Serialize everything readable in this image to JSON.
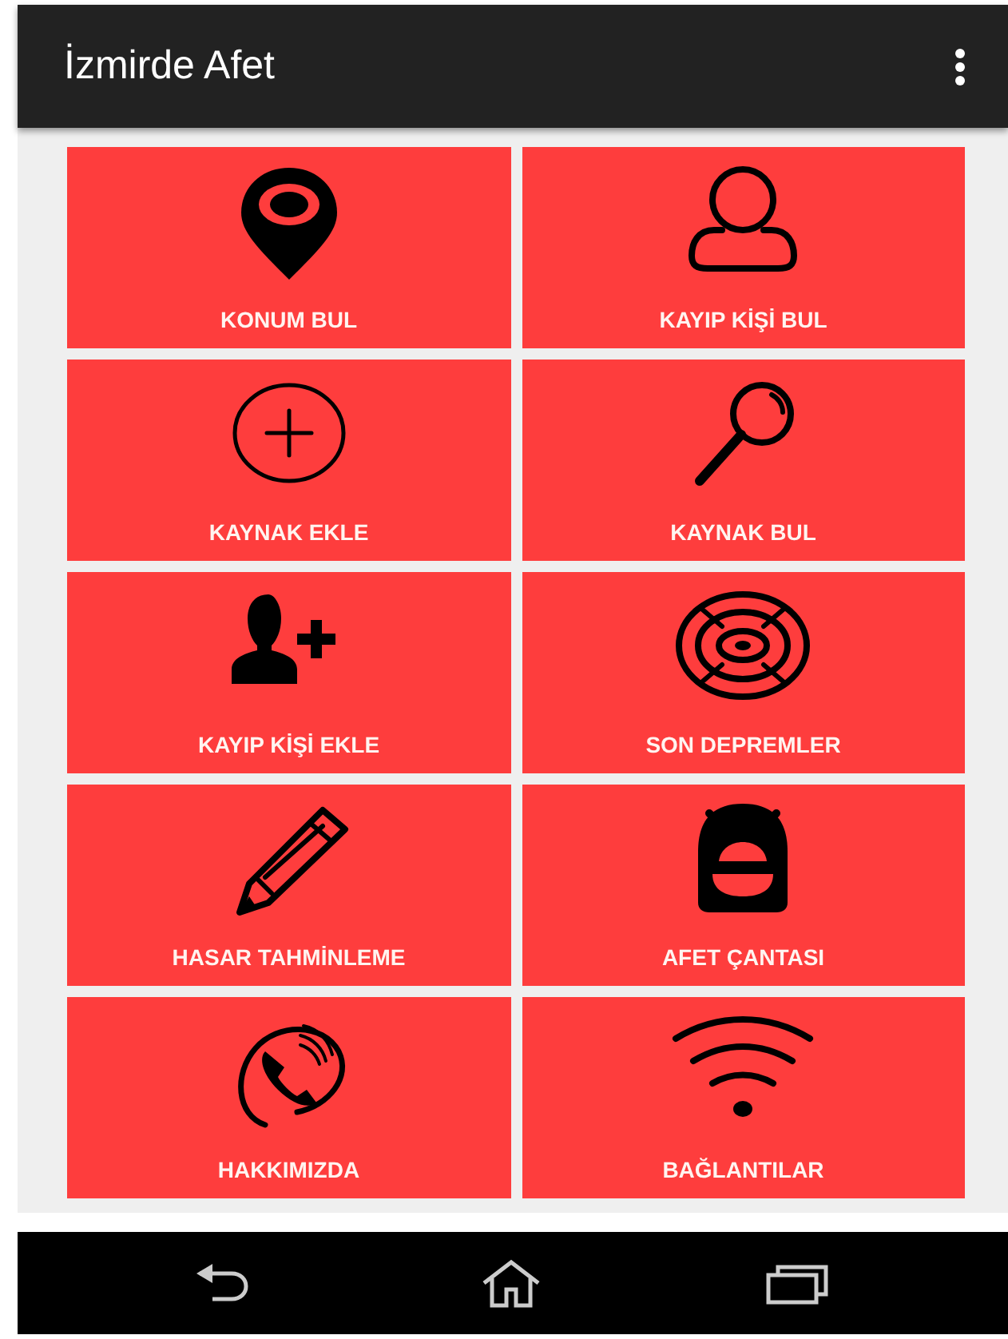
{
  "app_bar": {
    "title": "İzmirde Afet"
  },
  "tiles": [
    {
      "label": "KONUM BUL"
    },
    {
      "label": "KAYIP KİŞİ BUL"
    },
    {
      "label": "KAYNAK EKLE"
    },
    {
      "label": "KAYNAK BUL"
    },
    {
      "label": "KAYIP KİŞİ EKLE"
    },
    {
      "label": "SON DEPREMLER"
    },
    {
      "label": "HASAR TAHMİNLEME"
    },
    {
      "label": "AFET ÇANTASI"
    },
    {
      "label": "HAKKIMIZDA"
    },
    {
      "label": "BAĞLANTILAR"
    }
  ]
}
